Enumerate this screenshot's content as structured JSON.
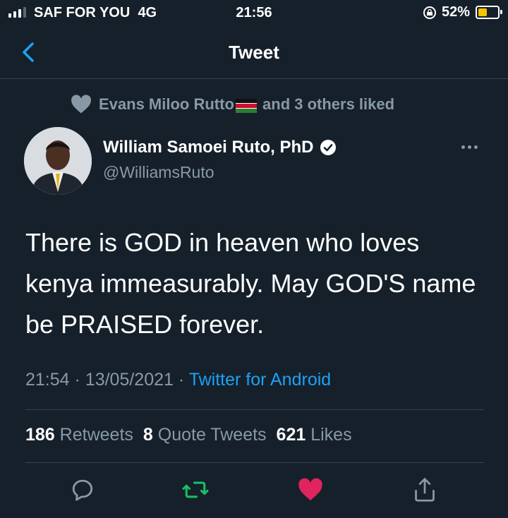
{
  "status_bar": {
    "carrier": "SAF FOR YOU",
    "network": "4G",
    "time": "21:56",
    "battery": "52%",
    "battery_level": 0.52
  },
  "nav": {
    "title": "Tweet"
  },
  "social_context": {
    "liker": "Evans Miloo Rutto",
    "suffix": "and 3 others liked"
  },
  "author": {
    "name": "William Samoei Ruto, PhD",
    "handle": "@WilliamsRuto",
    "verified": true
  },
  "tweet": {
    "text": "There is GOD in heaven who loves kenya immeasurably. May GOD'S name be PRAISED forever.",
    "time": "21:54",
    "date": "13/05/2021",
    "source": "Twitter for Android",
    "separator": "·"
  },
  "stats": {
    "retweets_count": "186",
    "retweets_label": "Retweets",
    "quotes_count": "8",
    "quotes_label": "Quote Tweets",
    "likes_count": "621",
    "likes_label": "Likes"
  },
  "actions": {
    "reply": "reply-icon",
    "retweet": "retweet-icon",
    "like": "heart-icon",
    "share": "share-icon"
  },
  "colors": {
    "background": "#15202b",
    "accent": "#1da1f2",
    "secondary_text": "#8899a6",
    "retweet": "#17bf63",
    "like": "#e0245e",
    "battery": "#f5c400"
  }
}
